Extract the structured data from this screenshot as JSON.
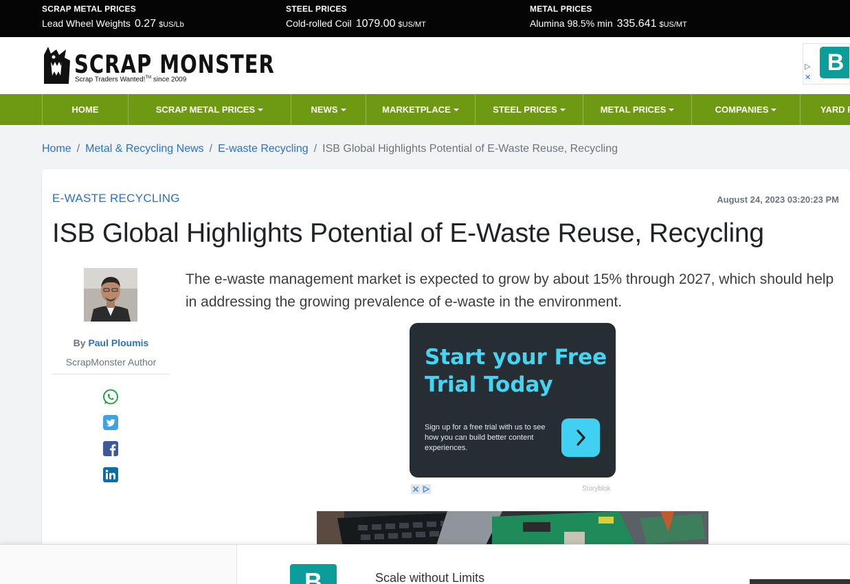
{
  "ticker": [
    {
      "title": "SCRAP METAL PRICES",
      "name": "Lead Wheel Weights",
      "value": "0.27",
      "unit": "$US/Lb"
    },
    {
      "title": "STEEL PRICES",
      "name": "Cold-rolled Coil",
      "value": "1079.00",
      "unit": "$US/MT"
    },
    {
      "title": "METAL PRICES",
      "name": "Alumina 98.5% min",
      "value": "335.641",
      "unit": "$US/MT"
    }
  ],
  "brand": {
    "name": "SCRAP MONSTER",
    "tagline": "Scrap Traders Wanted!",
    "trademark": "TM",
    "since": "since 2009"
  },
  "header_ad": {
    "letter": "B",
    "icon": "adchoices-icon"
  },
  "nav": [
    {
      "label": "HOME",
      "dropdown": false
    },
    {
      "label": "SCRAP METAL PRICES",
      "dropdown": true
    },
    {
      "label": "NEWS",
      "dropdown": true
    },
    {
      "label": "MARKETPLACE",
      "dropdown": true
    },
    {
      "label": "STEEL PRICES",
      "dropdown": true
    },
    {
      "label": "METAL PRICES",
      "dropdown": true
    },
    {
      "label": "COMPANIES",
      "dropdown": true
    },
    {
      "label": "YARD F",
      "dropdown": false
    }
  ],
  "breadcrumb": {
    "items": [
      "Home",
      "Metal & Recycling News",
      "E-waste Recycling"
    ],
    "separator": "/",
    "current": "ISB Global Highlights Potential of E-Waste Reuse, Recycling"
  },
  "article": {
    "category": "E-WASTE RECYCLING",
    "date": "August 24, 2023 03:20:23 PM",
    "title": "ISB Global Highlights Potential of E-Waste Reuse, Recycling",
    "author_prefix": "By",
    "author": "Paul Ploumis",
    "author_role": "ScrapMonster Author",
    "summary": "The e-waste management market is expected to grow by about 15% through 2027, which should help in addressing the growing prevalence of e-waste in the environment.",
    "share_icons": [
      "whatsapp-icon",
      "twitter-icon",
      "facebook-icon",
      "linkedin-icon"
    ]
  },
  "promo_ad": {
    "title": "Start your Free Trial Today",
    "text": "Sign up for a free trial with us to see how you can build better content experiences.",
    "brand": "Storyblok"
  },
  "bottom_ad": {
    "letter": "B",
    "text": "Scale without Limits"
  },
  "colors": {
    "ticker_bg": "#050505",
    "nav_bg": "#6e9a13",
    "link": "#2a72c7",
    "promo_bg": "#262d33",
    "promo_accent": "#44d4f4",
    "ad_teal": "#0a9d9a"
  }
}
